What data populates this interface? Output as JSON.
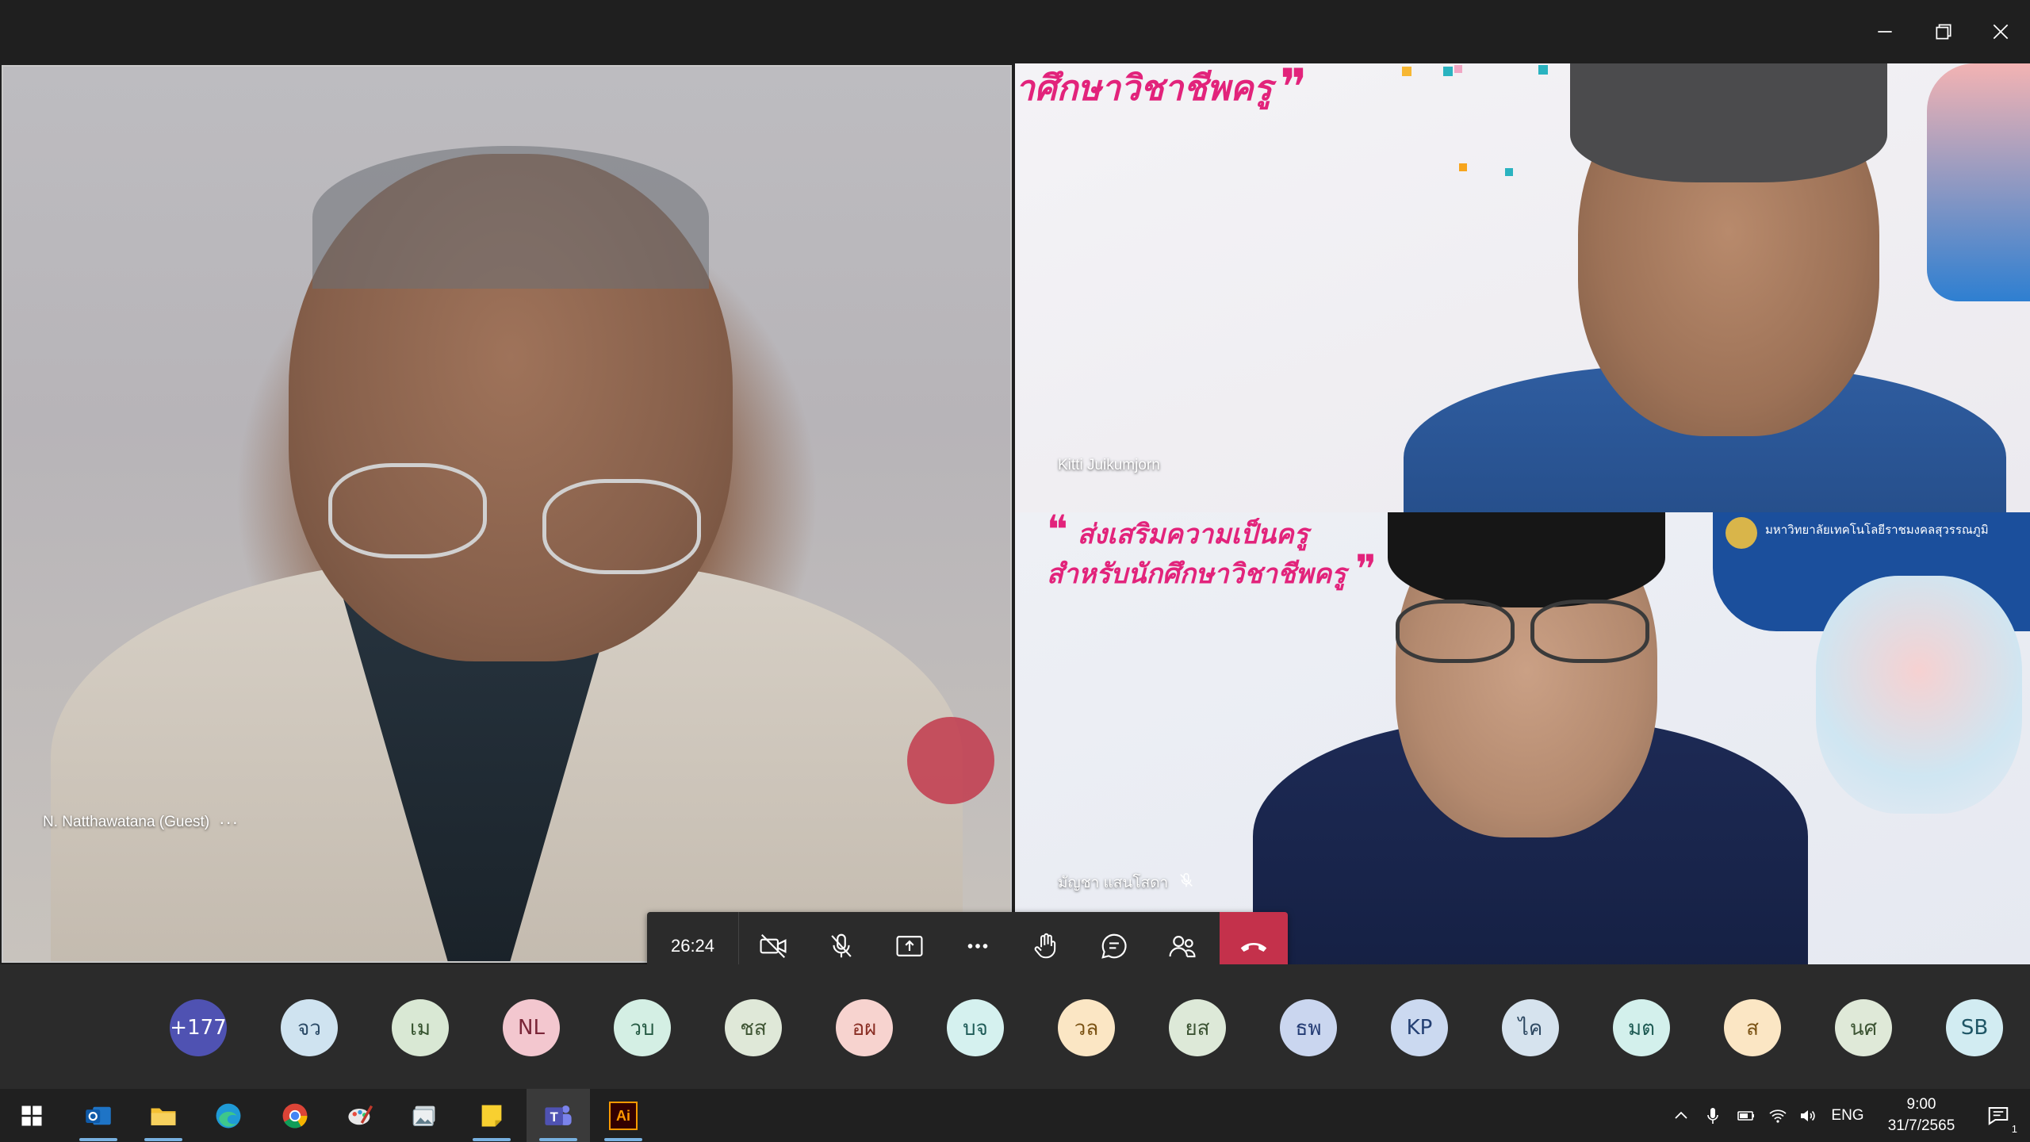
{
  "window": {
    "controls": [
      "minimize",
      "restore",
      "close"
    ]
  },
  "tiles": {
    "left": {
      "name": "N. Natthawatana (Guest)",
      "more": "···"
    },
    "top_right": {
      "name": "Kitti Juikumjorn",
      "banner_text": "าศึกษาวิชาชีพครู",
      "banner_quote": "❞"
    },
    "bottom_right": {
      "name": "มัญชา แสนโสดา",
      "banner_line1": "ส่งเสริมความเป็นครู",
      "banner_line2": "สำหรับนักศึกษาวิชาชีพครู",
      "quote_open": "❝",
      "quote_close": "❞",
      "logo_text": "มหาวิทยาลัยเทคโนโลยีราชมงคลสุวรรณภูมิ"
    }
  },
  "call_controls": {
    "timer": "26:24",
    "buttons": [
      "camera-off",
      "mic-off",
      "share",
      "more",
      "raise-hand",
      "chat",
      "participants",
      "hang-up"
    ]
  },
  "participants": [
    {
      "initials": "+177",
      "bg": "#4f52b2",
      "fg": "#ffffff"
    },
    {
      "initials": "จว",
      "bg": "#cfe3f0",
      "fg": "#2b4a66"
    },
    {
      "initials": "เม",
      "bg": "#d9e8d4",
      "fg": "#33502c"
    },
    {
      "initials": "NL",
      "bg": "#f3c7cf",
      "fg": "#7a2638"
    },
    {
      "initials": "วบ",
      "bg": "#d4efe4",
      "fg": "#255a43"
    },
    {
      "initials": "ชส",
      "bg": "#dfe8d8",
      "fg": "#3f5534"
    },
    {
      "initials": "อผ",
      "bg": "#f7d3cf",
      "fg": "#8a2f25"
    },
    {
      "initials": "บจ",
      "bg": "#d5f1ef",
      "fg": "#1f5c58"
    },
    {
      "initials": "วล",
      "bg": "#fbe6c4",
      "fg": "#7a5213"
    },
    {
      "initials": "ยส",
      "bg": "#dde9d8",
      "fg": "#3c5433"
    },
    {
      "initials": "ธพ",
      "bg": "#cad6ef",
      "fg": "#243c74"
    },
    {
      "initials": "KP",
      "bg": "#cbd9f0",
      "fg": "#233f73"
    },
    {
      "initials": "ไค",
      "bg": "#d6e3ee",
      "fg": "#2f4a63"
    },
    {
      "initials": "มต",
      "bg": "#d3f0ec",
      "fg": "#1e5b54"
    },
    {
      "initials": "ส",
      "bg": "#fbe6c4",
      "fg": "#7a5213"
    },
    {
      "initials": "นศ",
      "bg": "#dfe9d8",
      "fg": "#3c5433"
    },
    {
      "initials": "SB",
      "bg": "#d2ecf2",
      "fg": "#1f5666"
    }
  ],
  "taskbar": {
    "apps": [
      "windows-start",
      "outlook",
      "file-explorer",
      "edge",
      "chrome",
      "paint",
      "photos",
      "sticky-notes",
      "teams",
      "illustrator"
    ],
    "illustrator_label": "Ai",
    "teams_label": "T",
    "language": "ENG",
    "time": "9:00",
    "date": "31/7/2565",
    "notifications": "1"
  },
  "colors": {
    "accent": "#4f52b2",
    "hangup": "#c4314b",
    "banner_pink": "#e2237b"
  }
}
